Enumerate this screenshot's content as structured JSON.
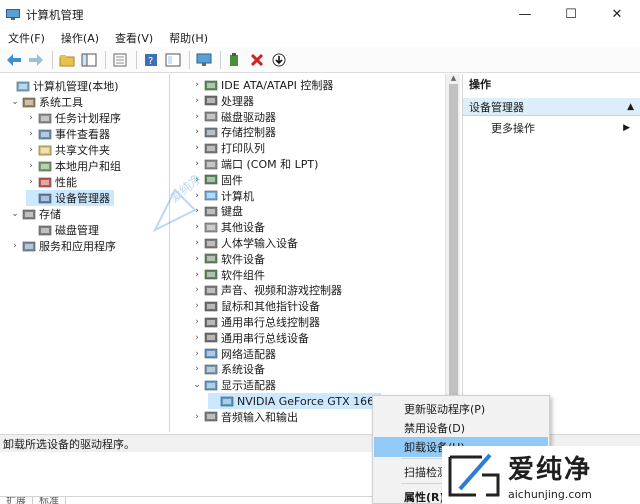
{
  "window": {
    "title": "计算机管理",
    "controls": [
      "—",
      "☐",
      "✕"
    ]
  },
  "menu": [
    "文件(F)",
    "操作(A)",
    "查看(V)",
    "帮助(H)"
  ],
  "left_tree": [
    {
      "label": "计算机管理(本地)",
      "level": 0,
      "chevron": "",
      "icon": "computer-management-icon",
      "selected": false
    },
    {
      "label": "系统工具",
      "level": 1,
      "chevron": "v",
      "icon": "tools-icon",
      "selected": false
    },
    {
      "label": "任务计划程序",
      "level": 2,
      "chevron": ">",
      "icon": "clock-icon",
      "selected": false
    },
    {
      "label": "事件查看器",
      "level": 2,
      "chevron": ">",
      "icon": "event-viewer-icon",
      "selected": false
    },
    {
      "label": "共享文件夹",
      "level": 2,
      "chevron": ">",
      "icon": "shared-folder-icon",
      "selected": false
    },
    {
      "label": "本地用户和组",
      "level": 2,
      "chevron": ">",
      "icon": "users-icon",
      "selected": false
    },
    {
      "label": "性能",
      "level": 2,
      "chevron": ">",
      "icon": "performance-icon",
      "selected": false
    },
    {
      "label": "设备管理器",
      "level": 2,
      "chevron": "",
      "icon": "device-manager-icon",
      "selected": true
    },
    {
      "label": "存储",
      "level": 1,
      "chevron": "v",
      "icon": "storage-icon",
      "selected": false
    },
    {
      "label": "磁盘管理",
      "level": 2,
      "chevron": "",
      "icon": "disk-management-icon",
      "selected": false
    },
    {
      "label": "服务和应用程序",
      "level": 1,
      "chevron": ">",
      "icon": "services-icon",
      "selected": false
    }
  ],
  "device_tree": [
    {
      "label": "IDE ATA/ATAPI 控制器",
      "chevron": ">",
      "icon": "ide-controller-icon"
    },
    {
      "label": "处理器",
      "chevron": ">",
      "icon": "processor-icon"
    },
    {
      "label": "磁盘驱动器",
      "chevron": ">",
      "icon": "disk-drive-icon"
    },
    {
      "label": "存储控制器",
      "chevron": ">",
      "icon": "storage-controller-icon"
    },
    {
      "label": "打印队列",
      "chevron": ">",
      "icon": "print-queue-icon"
    },
    {
      "label": "端口 (COM 和 LPT)",
      "chevron": ">",
      "icon": "port-icon"
    },
    {
      "label": "固件",
      "chevron": ">",
      "icon": "firmware-icon"
    },
    {
      "label": "计算机",
      "chevron": ">",
      "icon": "computer-icon"
    },
    {
      "label": "键盘",
      "chevron": ">",
      "icon": "keyboard-icon"
    },
    {
      "label": "其他设备",
      "chevron": ">",
      "icon": "other-devices-icon"
    },
    {
      "label": "人体学输入设备",
      "chevron": ">",
      "icon": "hid-icon"
    },
    {
      "label": "软件设备",
      "chevron": ">",
      "icon": "software-device-icon"
    },
    {
      "label": "软件组件",
      "chevron": ">",
      "icon": "software-component-icon"
    },
    {
      "label": "声音、视频和游戏控制器",
      "chevron": ">",
      "icon": "audio-video-icon"
    },
    {
      "label": "鼠标和其他指针设备",
      "chevron": ">",
      "icon": "mouse-icon"
    },
    {
      "label": "通用串行总线控制器",
      "chevron": ">",
      "icon": "usb-controller-icon"
    },
    {
      "label": "通用串行总线设备",
      "chevron": ">",
      "icon": "usb-device-icon"
    },
    {
      "label": "网络适配器",
      "chevron": ">",
      "icon": "network-adapter-icon"
    },
    {
      "label": "系统设备",
      "chevron": ">",
      "icon": "system-device-icon"
    },
    {
      "label": "显示适配器",
      "chevron": "v",
      "icon": "display-adapter-icon"
    },
    {
      "label": "NVIDIA GeForce GTX 1660",
      "chevron": "",
      "icon": "gpu-icon",
      "child": true
    },
    {
      "label": "音频输入和输出",
      "chevron": ">",
      "icon": "audio-io-icon"
    }
  ],
  "actions": {
    "header": "操作",
    "section": "设备管理器",
    "item": "更多操作"
  },
  "status": "卸载所选设备的驱动程序。",
  "context_menu": [
    {
      "label": "更新驱动程序(P)",
      "highlight": false
    },
    {
      "label": "禁用设备(D)",
      "highlight": false
    },
    {
      "label": "卸载设备(U)",
      "highlight": true
    },
    {
      "label": "扫描检测硬件改动(A)",
      "highlight": false
    },
    {
      "label": "属性(R)",
      "highlight": false,
      "bold": true
    }
  ],
  "bottom_tabs": [
    "扩展",
    "标准"
  ],
  "logo": {
    "name": "爱纯净",
    "url": "aichunjing.com"
  },
  "watermark_mid": "爱纯净",
  "colors": {
    "selection": "#cce8ff",
    "context_highlight": "#91c9f7",
    "action_section": "#dbeefa"
  }
}
